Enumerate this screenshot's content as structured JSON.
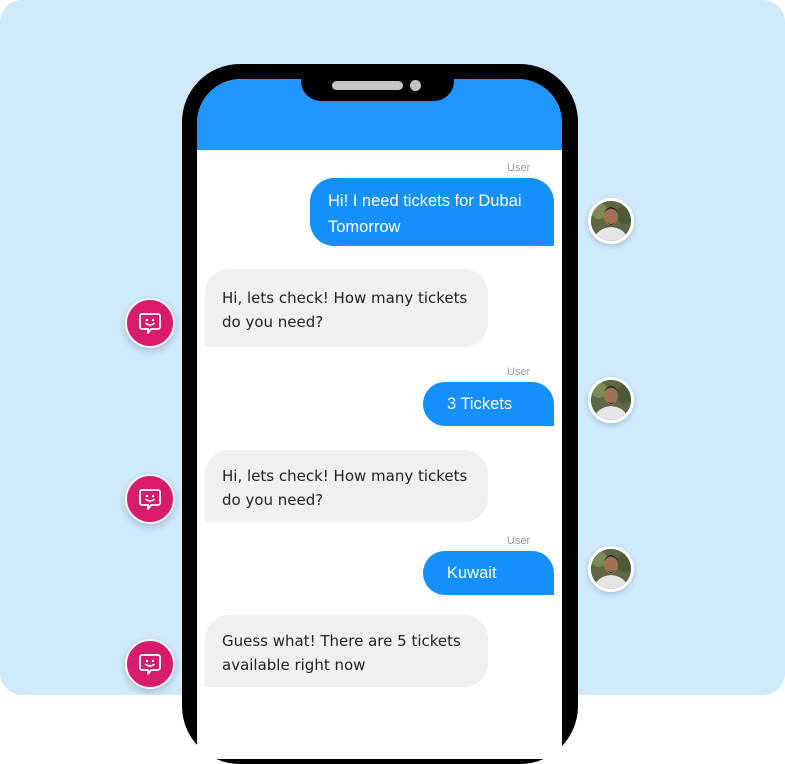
{
  "theme": {
    "background": "#cfeafd",
    "header_color": "#2196fe",
    "user_bubble_color": "#1390fb",
    "bot_bubble_color": "#f0f0f0",
    "bot_icon_color": "#d81b6b"
  },
  "phone": {
    "header": {
      "title": ""
    }
  },
  "messages": [
    {
      "sender": "user",
      "sender_label": "User",
      "text": "Hi! I need tickets for Dubai Tomorrow",
      "avatar_icon": "user-avatar"
    },
    {
      "sender": "bot",
      "text": "Hi, lets check! How many tickets do you need?",
      "avatar_icon": "chatbot-icon"
    },
    {
      "sender": "user",
      "sender_label": "User",
      "text": "3 Tickets",
      "avatar_icon": "user-avatar"
    },
    {
      "sender": "bot",
      "text": "Hi, lets check! How many tickets do you need?",
      "avatar_icon": "chatbot-icon"
    },
    {
      "sender": "user",
      "sender_label": "User",
      "text": "Kuwait",
      "avatar_icon": "user-avatar"
    },
    {
      "sender": "bot",
      "text": "Guess what! There are 5 tickets available right now",
      "avatar_icon": "chatbot-icon"
    }
  ]
}
